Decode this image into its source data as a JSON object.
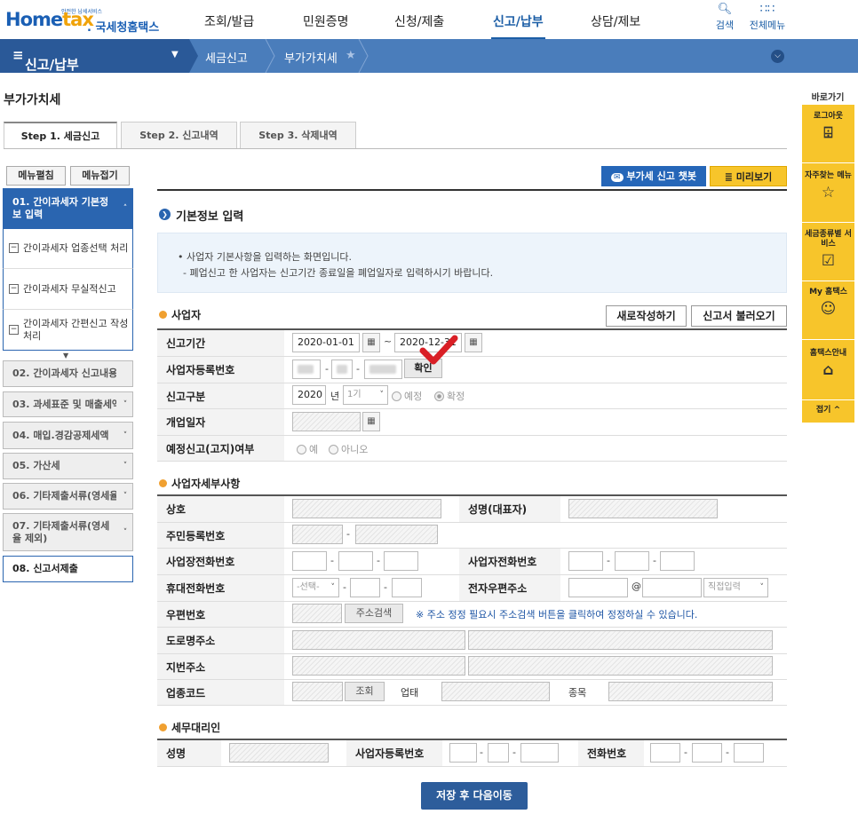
{
  "header": {
    "logo_small": "안전한 납세서비스",
    "logo_main_a": "Home",
    "logo_main_b": "tax",
    "logo_sub": ". 국세청홈택스",
    "nav": [
      "조회/발급",
      "민원증명",
      "신청/제출",
      "신고/납부",
      "상담/제보"
    ],
    "active_nav": "신고/납부",
    "search_label": "검색",
    "allmenu_label": "전체메뉴"
  },
  "navbar": {
    "section": "신고/납부",
    "crumbs": [
      "세금신고",
      "부가가치세"
    ]
  },
  "page_title": "부가가치세",
  "tabs": [
    "Step 1. 세금신고",
    "Step 2. 신고내역",
    "Step 3. 삭제내역"
  ],
  "left_menu": {
    "expand": "메뉴펼침",
    "collapse": "메뉴접기",
    "active": "01. 간이과세자 기본정보 입력",
    "subitems": [
      "간이과세자 업종선택 처리",
      "간이과세자 무실적신고",
      "간이과세자 간편신고 작성 처리"
    ],
    "items": [
      "02. 간이과세자 신고내용",
      "03. 과세표준 및 매출세액",
      "04. 매입.경감공제세액",
      "05. 가산세",
      "06. 기타제출서류(영세율",
      "07. 기타제출서류(영세율 제외)",
      "08. 신고서제출"
    ]
  },
  "quick": {
    "label": "바로가기",
    "items": [
      "로그아웃",
      "자주찾는 메뉴",
      "세금종류별 서비스",
      "My 홈택스",
      "홈택스안내"
    ],
    "fold": "접기 ^"
  },
  "top_buttons": {
    "chatbot": "부가세 신고 챗봇",
    "preview": "미리보기"
  },
  "section_title": "기본정보 입력",
  "info_lines": [
    "• 사업자 기본사항을 입력하는 화면입니다.",
    "- 폐업신고 한 사업자는 신고기간 종료일을 폐업일자로 입력하시기 바랍니다."
  ],
  "business": {
    "title": "사업자",
    "new_button": "새로작성하기",
    "load_button": "신고서 불러오기",
    "period_label": "신고기간",
    "period_from": "2020-01-01",
    "period_to": "2020-12-31",
    "bizno_label": "사업자등록번호",
    "confirm_button": "확인",
    "type_label": "신고구분",
    "year": "2020",
    "year_unit": "년",
    "half": "1기",
    "opt_estimate": "예정",
    "opt_final": "확정",
    "open_label": "개업일자",
    "notice_label": "예정신고(고지)여부",
    "opt_yes": "예",
    "opt_no": "아니오"
  },
  "details": {
    "title": "사업자세부사항",
    "name_label": "상호",
    "rep_label": "성명(대표자)",
    "rrn_label": "주민등록번호",
    "place_phone_label": "사업장전화번호",
    "biz_phone_label": "사업자전화번호",
    "mobile_label": "휴대전화번호",
    "mobile_select": "-선택-",
    "email_label": "전자우편주소",
    "email_at": "@",
    "email_select": "직접입력",
    "zip_label": "우편번호",
    "zip_button": "주소검색",
    "zip_note": "※ 주소 정정 필요시 주소검색 버튼을 클릭하여 정정하실 수 있습니다.",
    "road_label": "도로명주소",
    "lot_label": "지번주소",
    "industry_label": "업종코드",
    "industry_button": "조회",
    "biztype_label": "업태",
    "item_label": "종목"
  },
  "agent": {
    "title": "세무대리인",
    "name_label": "성명",
    "bizno_label": "사업자등록번호",
    "phone_label": "전화번호"
  },
  "submit": "저장 후 다음이동"
}
